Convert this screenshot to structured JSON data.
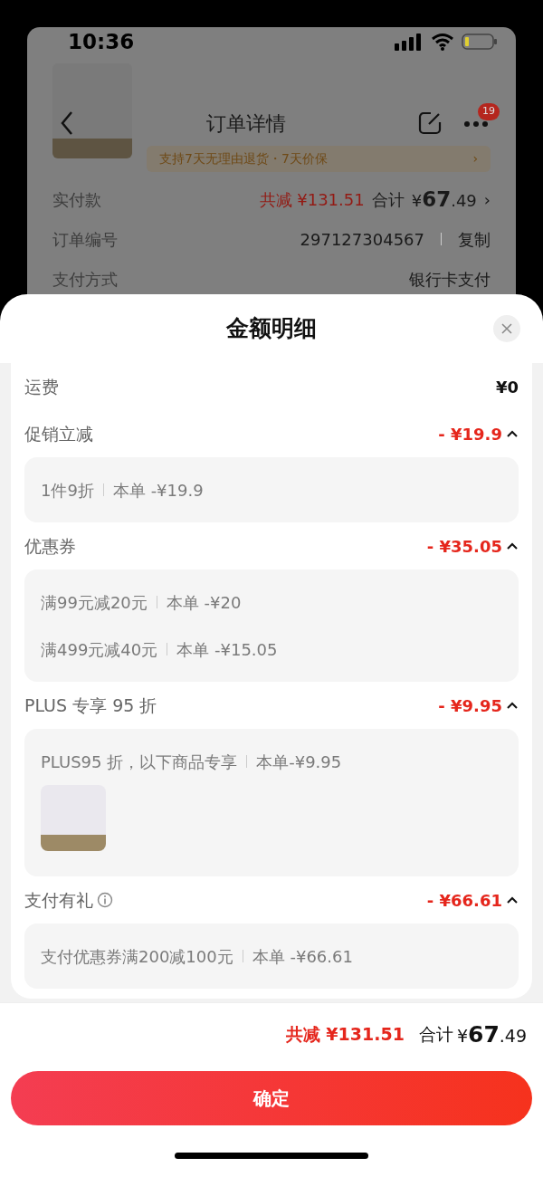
{
  "status_bar": {
    "time": "10:36"
  },
  "background_page": {
    "nav_title": "订单详情",
    "notification_count": "19",
    "promo": "支持7天无理由退货・7天价保",
    "promo_arrow": "›",
    "rows": [
      {
        "kind": "total",
        "label": "实付款",
        "discount": "共减 ¥131.51",
        "total_label": "合计",
        "total": "¥**67**.49",
        "arrow": "›"
      },
      {
        "kind": "copy",
        "label": "订单编号",
        "value": "297127304567",
        "action": "复制"
      },
      {
        "kind": "text",
        "label": "支付方式",
        "value": "银行卡支付"
      }
    ]
  },
  "sheet": {
    "title": "金额明细",
    "sections": [
      {
        "kind": "plain",
        "label": "运费",
        "amount": "¥0"
      },
      {
        "kind": "group",
        "label": "促销立减",
        "amount": "- ¥19.9",
        "expanded": true,
        "lines": [
          {
            "name": "1件9折",
            "detail": "本单 -¥19.9"
          }
        ]
      },
      {
        "kind": "group",
        "label": "优惠券",
        "amount": "- ¥35.05",
        "expanded": true,
        "lines": [
          {
            "name": "满99元减20元",
            "detail": "本单 -¥20"
          },
          {
            "name": "满499元减40元",
            "detail": "本单 -¥15.05"
          }
        ]
      },
      {
        "kind": "group",
        "label": "PLUS 专享 95 折",
        "amount": "- ¥9.95",
        "expanded": true,
        "product_thumbnail": true,
        "lines": [
          {
            "name": "PLUS95 折，以下商品专享",
            "detail": "本单-¥9.95"
          }
        ]
      },
      {
        "kind": "group",
        "label": "支付有礼",
        "info": true,
        "amount": "- ¥66.61",
        "expanded": true,
        "lines": [
          {
            "name": "支付优惠券满200减100元",
            "detail": "本单 -¥66.61"
          }
        ]
      }
    ],
    "footer": {
      "discount": "共减 ¥131.51",
      "total_label": "合计",
      "total": "¥**67**.49"
    },
    "confirm_button": "确定"
  }
}
